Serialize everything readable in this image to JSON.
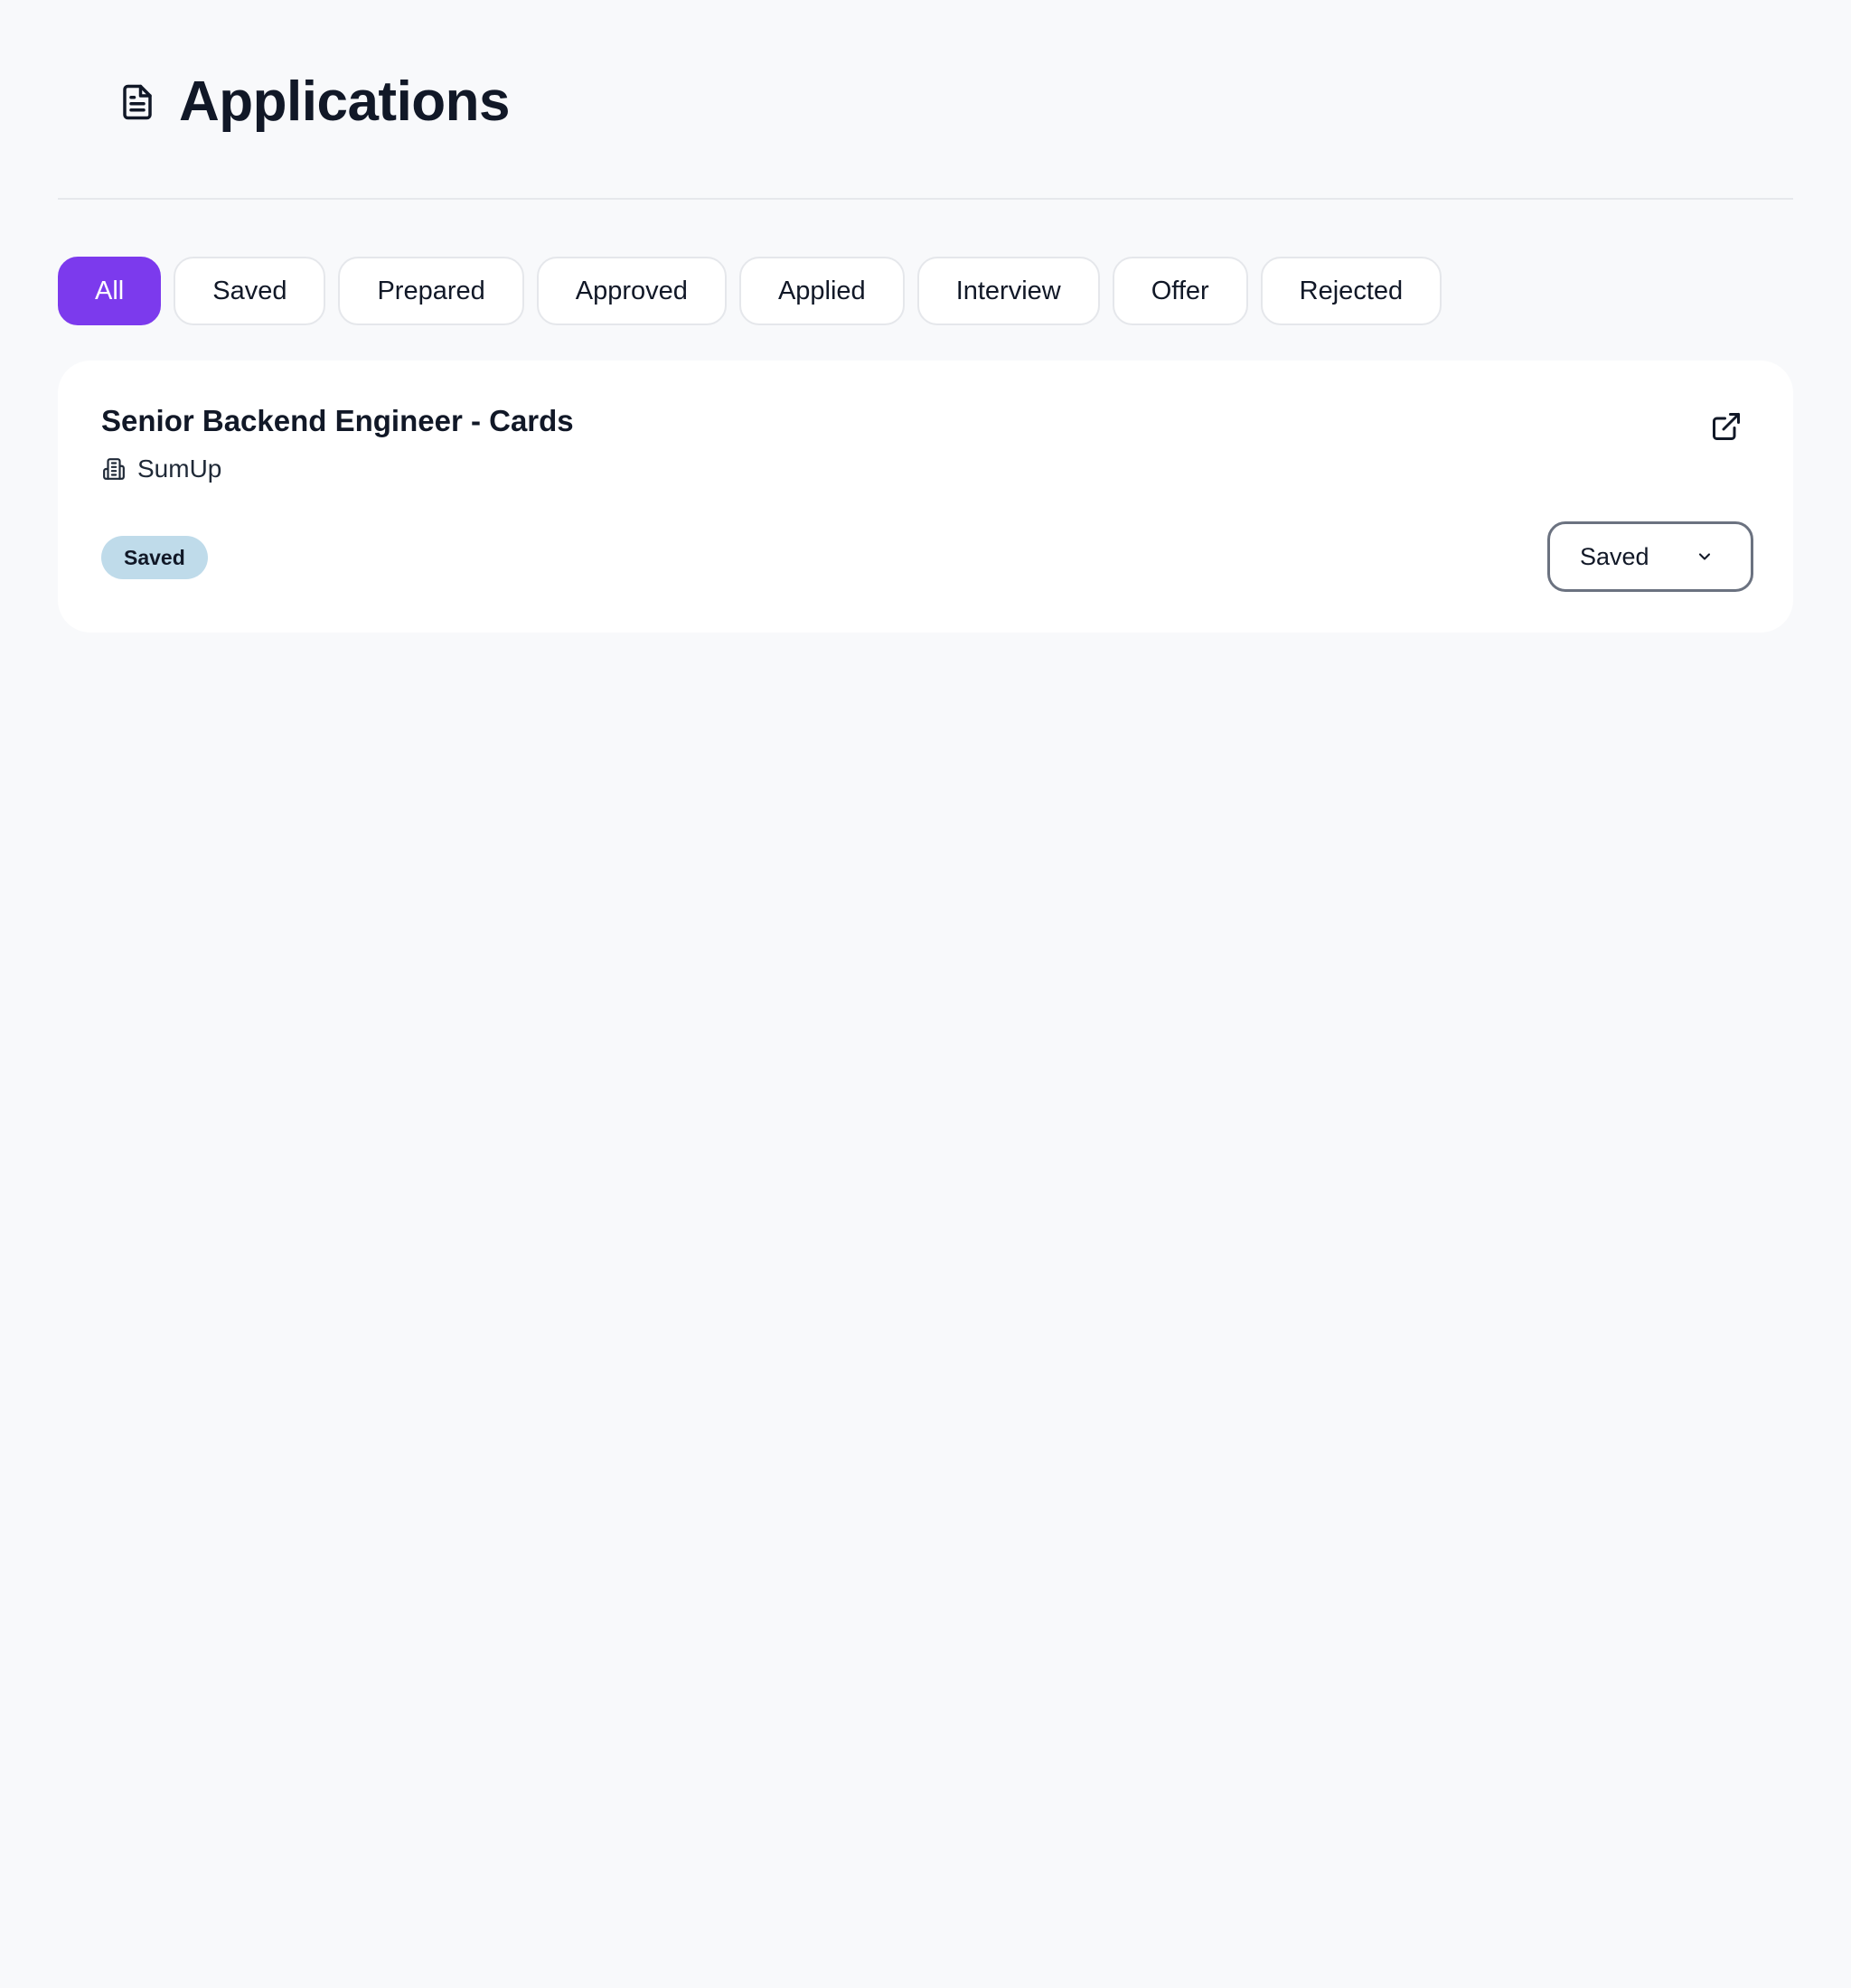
{
  "header": {
    "title": "Applications",
    "icon": "document-icon"
  },
  "filters": [
    {
      "label": "All",
      "active": true
    },
    {
      "label": "Saved",
      "active": false
    },
    {
      "label": "Prepared",
      "active": false
    },
    {
      "label": "Approved",
      "active": false
    },
    {
      "label": "Applied",
      "active": false
    },
    {
      "label": "Interview",
      "active": false
    },
    {
      "label": "Offer",
      "active": false
    },
    {
      "label": "Rejected",
      "active": false
    }
  ],
  "applications": [
    {
      "title": "Senior Backend Engineer - Cards",
      "company": "SumUp",
      "status_badge": "Saved",
      "status_select": "Saved"
    }
  ],
  "colors": {
    "accent": "#7c3aed",
    "badge_bg": "#bfdbea",
    "page_bg": "#f8f9fb"
  }
}
